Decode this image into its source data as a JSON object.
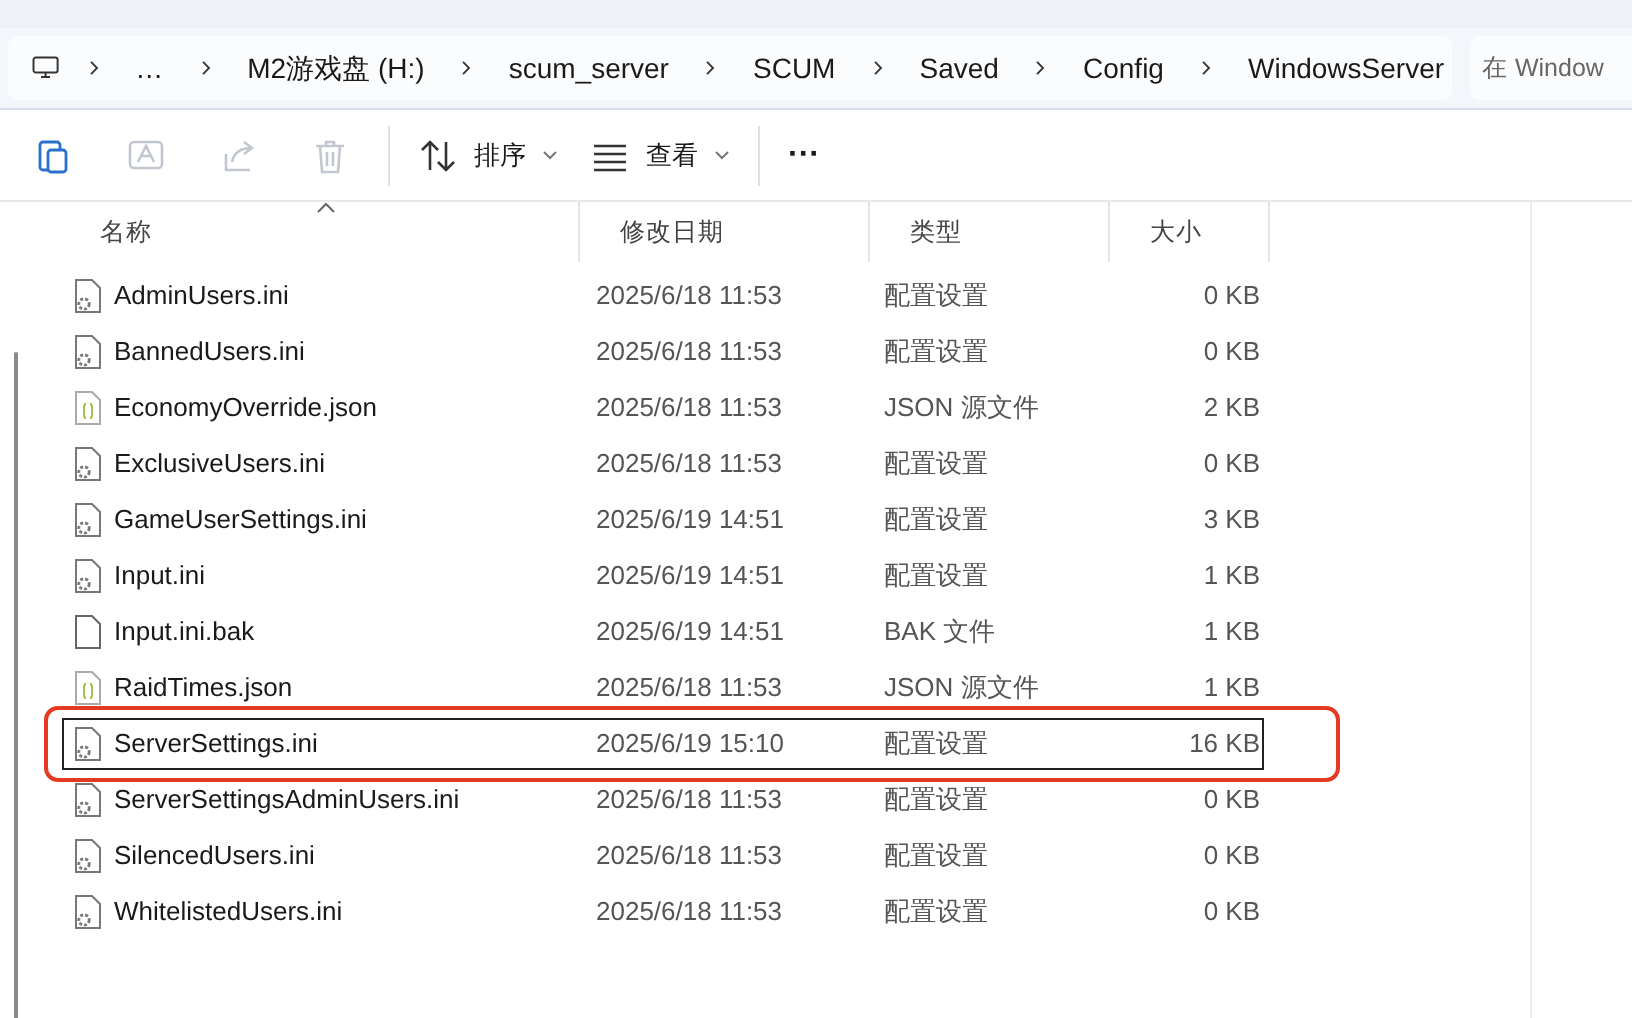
{
  "address_bar": {
    "crumbs": [
      "…",
      "M2游戏盘 (H:)",
      "scum_server",
      "SCUM",
      "Saved",
      "Config",
      "WindowsServer"
    ]
  },
  "search": {
    "placeholder": "在 Window"
  },
  "toolbar": [
    {
      "kind": "copy",
      "disabled": false
    },
    {
      "kind": "rename",
      "disabled": true
    },
    {
      "kind": "share",
      "disabled": true
    },
    {
      "kind": "delete",
      "disabled": true
    },
    {
      "kind": "sort",
      "label": "排序",
      "disabled": false
    },
    {
      "kind": "view",
      "label": "查看",
      "disabled": false
    },
    {
      "kind": "more",
      "label": "···",
      "disabled": false
    }
  ],
  "table": {
    "columns": [
      "名称",
      "修改日期",
      "类型",
      "大小"
    ],
    "rows": [
      {
        "kind": "ini",
        "name": "AdminUsers.ini",
        "date": "2025/6/18 11:53",
        "type": "配置设置",
        "size": "0 KB",
        "selected": false,
        "highlighted": false
      },
      {
        "kind": "ini",
        "name": "BannedUsers.ini",
        "date": "2025/6/18 11:53",
        "type": "配置设置",
        "size": "0 KB",
        "selected": false,
        "highlighted": false
      },
      {
        "kind": "json",
        "name": "EconomyOverride.json",
        "date": "2025/6/18 11:53",
        "type": "JSON 源文件",
        "size": "2 KB",
        "selected": false,
        "highlighted": false
      },
      {
        "kind": "ini",
        "name": "ExclusiveUsers.ini",
        "date": "2025/6/18 11:53",
        "type": "配置设置",
        "size": "0 KB",
        "selected": false,
        "highlighted": false
      },
      {
        "kind": "ini",
        "name": "GameUserSettings.ini",
        "date": "2025/6/19 14:51",
        "type": "配置设置",
        "size": "3 KB",
        "selected": false,
        "highlighted": false
      },
      {
        "kind": "ini",
        "name": "Input.ini",
        "date": "2025/6/19 14:51",
        "type": "配置设置",
        "size": "1 KB",
        "selected": false,
        "highlighted": false
      },
      {
        "kind": "bak",
        "name": "Input.ini.bak",
        "date": "2025/6/19 14:51",
        "type": "BAK 文件",
        "size": "1 KB",
        "selected": false,
        "highlighted": false
      },
      {
        "kind": "json",
        "name": "RaidTimes.json",
        "date": "2025/6/18 11:53",
        "type": "JSON 源文件",
        "size": "1 KB",
        "selected": false,
        "highlighted": false
      },
      {
        "kind": "ini",
        "name": "ServerSettings.ini",
        "date": "2025/6/19 15:10",
        "type": "配置设置",
        "size": "16 KB",
        "selected": true,
        "highlighted": true
      },
      {
        "kind": "ini",
        "name": "ServerSettingsAdminUsers.ini",
        "date": "2025/6/18 11:53",
        "type": "配置设置",
        "size": "0 KB",
        "selected": false,
        "highlighted": false
      },
      {
        "kind": "ini",
        "name": "SilencedUsers.ini",
        "date": "2025/6/18 11:53",
        "type": "配置设置",
        "size": "0 KB",
        "selected": false,
        "highlighted": false
      },
      {
        "kind": "ini",
        "name": "WhitelistedUsers.ini",
        "date": "2025/6/18 11:53",
        "type": "配置设置",
        "size": "0 KB",
        "selected": false,
        "highlighted": false
      }
    ]
  }
}
